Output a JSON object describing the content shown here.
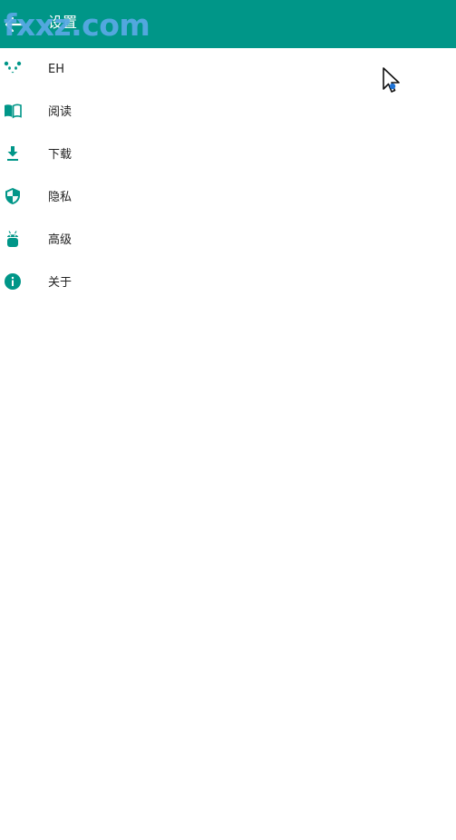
{
  "app_bar": {
    "title": "设置",
    "watermark": "fxxz.com",
    "color": "#009688"
  },
  "settings": {
    "items": [
      {
        "label": "EH",
        "icon": "panda-icon"
      },
      {
        "label": "阅读",
        "icon": "book-icon"
      },
      {
        "label": "下载",
        "icon": "download-icon"
      },
      {
        "label": "隐私",
        "icon": "shield-icon"
      },
      {
        "label": "高级",
        "icon": "android-icon"
      },
      {
        "label": "关于",
        "icon": "info-icon"
      }
    ]
  },
  "colors": {
    "accent": "#009688",
    "text": "#222222",
    "background": "#ffffff"
  }
}
